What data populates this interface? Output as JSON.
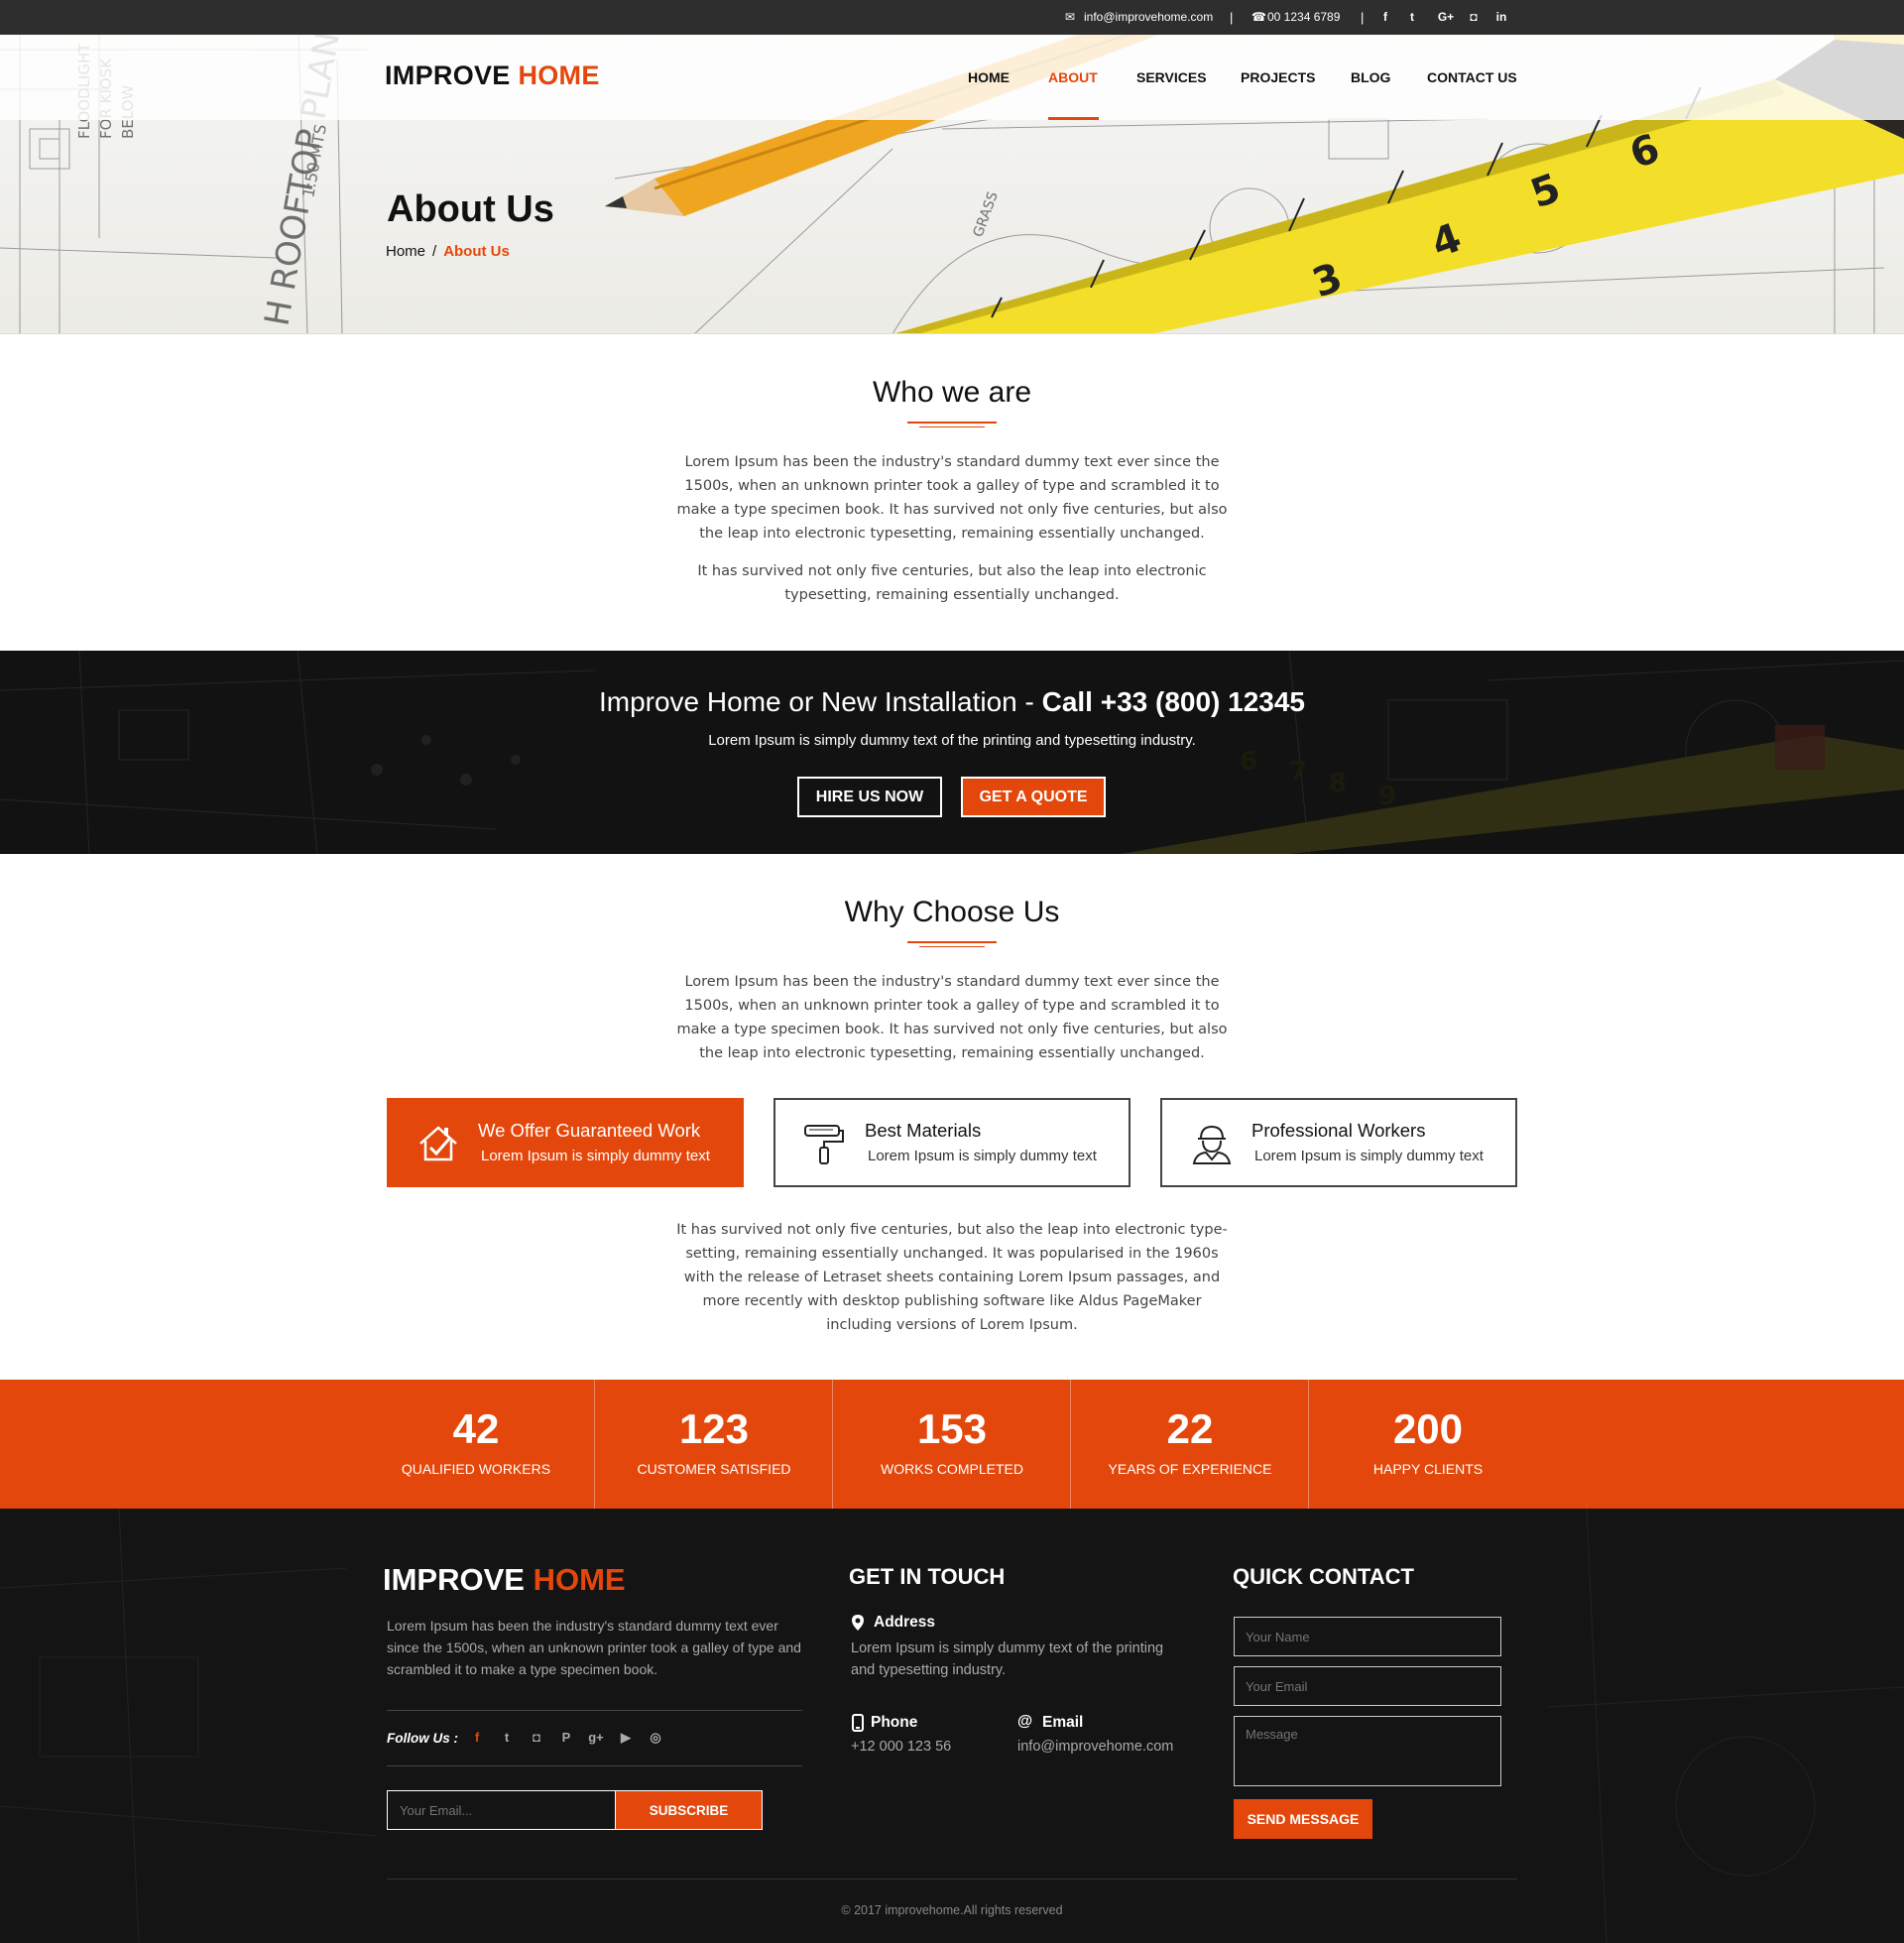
{
  "colors": {
    "accent": "#e4470b",
    "dark": "#1d1d1d",
    "footer_bg": "#141414"
  },
  "topbar": {
    "email": "info@improvehome.com",
    "phone": "00 1234 6789",
    "separator": "|",
    "social": [
      {
        "icon": "facebook-icon",
        "glyph": "f"
      },
      {
        "icon": "twitter-icon",
        "glyph": "t"
      },
      {
        "icon": "google-plus-icon",
        "glyph": "G+"
      },
      {
        "icon": "instagram-icon",
        "glyph": "◘"
      },
      {
        "icon": "linkedin-icon",
        "glyph": "in"
      }
    ]
  },
  "brand": {
    "part1": "IMPROVE",
    "part2": "HOME"
  },
  "nav": {
    "items": [
      {
        "label": "HOME",
        "active": false
      },
      {
        "label": "ABOUT",
        "active": true
      },
      {
        "label": "SERVICES",
        "active": false
      },
      {
        "label": "PROJECTS",
        "active": false
      },
      {
        "label": "BLOG",
        "active": false
      },
      {
        "label": "CONTACT US",
        "active": false
      }
    ]
  },
  "hero": {
    "title": "About Us",
    "breadcrumb": {
      "home": "Home",
      "separator": "/",
      "current": "About Us"
    }
  },
  "who": {
    "title": "Who we are",
    "p1": "Lorem Ipsum has been the industry's standard dummy text ever since the 1500s, when an unknown printer took a galley of type and scrambled it to make a type specimen book. It has survived not only five centuries, but also the leap into electronic typesetting, remaining essentially unchanged.",
    "p2": "It has survived not only five centuries, but also the leap into electronic typesetting, remaining essentially unchanged."
  },
  "cta": {
    "title_lead": "Improve Home or New Installation - ",
    "title_call": "Call +33 (800) 12345",
    "subtitle": "Lorem Ipsum is simply dummy text of the printing and typesetting industry.",
    "hire_label": "HIRE US NOW",
    "quote_label": "GET A QUOTE"
  },
  "why": {
    "title": "Why Choose Us",
    "p1": "Lorem Ipsum has been the industry's standard dummy text ever since the 1500s, when an unknown printer took a galley of type and scrambled it to make a type specimen book. It has survived not only five centuries, but also the leap into electronic typesetting, remaining essentially unchanged.",
    "features": [
      {
        "title": "We Offer Guaranteed Work",
        "text": "Lorem Ipsum is simply dummy text",
        "icon": "house-check-icon",
        "active": true
      },
      {
        "title": "Best Materials",
        "text": "Lorem Ipsum is simply dummy text",
        "icon": "paint-roller-icon",
        "active": false
      },
      {
        "title": "Professional Workers",
        "text": "Lorem Ipsum is simply dummy text",
        "icon": "worker-icon",
        "active": false
      }
    ],
    "p2": "It has survived not only five centuries, but also the leap into electronic type-setting, remaining essentially unchanged. It was popularised in the 1960s with the release of Letraset sheets containing Lorem Ipsum passages, and more recently with desktop publishing software like Aldus PageMaker including versions of Lorem Ipsum."
  },
  "stats": [
    {
      "value": "42",
      "label": "QUALIFIED WORKERS"
    },
    {
      "value": "123",
      "label": "CUSTOMER SATISFIED"
    },
    {
      "value": "153",
      "label": "WORKS COMPLETED"
    },
    {
      "value": "22",
      "label": "YEARS OF EXPERIENCE"
    },
    {
      "value": "200",
      "label": "HAPPY CLIENTS"
    }
  ],
  "footer": {
    "about": "Lorem Ipsum has been the industry's standard dummy text ever since the 1500s, when an unknown printer took a galley of type and scrambled it to make a type specimen book.",
    "follow_label": "Follow Us :",
    "social": [
      {
        "icon": "facebook-icon",
        "glyph": "f"
      },
      {
        "icon": "twitter-icon",
        "glyph": "t"
      },
      {
        "icon": "instagram-icon",
        "glyph": "◘"
      },
      {
        "icon": "pinterest-icon",
        "glyph": "P"
      },
      {
        "icon": "google-plus-icon",
        "glyph": "g+"
      },
      {
        "icon": "youtube-icon",
        "glyph": "▶"
      },
      {
        "icon": "dribbble-icon",
        "glyph": "◎"
      }
    ],
    "subscribe_placeholder": "Your Email...",
    "subscribe_label": "SUBSCRIBE",
    "touch": {
      "title": "GET IN TOUCH",
      "address_label": "Address",
      "address_text": "Lorem Ipsum is simply dummy text of the printing and typesetting industry.",
      "phone_label": "Phone",
      "phone_value": "+12 000 123 56",
      "email_label": "Email",
      "email_value": "info@improvehome.com"
    },
    "quick": {
      "title": "QUICK CONTACT",
      "name_placeholder": "Your Name",
      "email_placeholder": "Your Email",
      "message_placeholder": "Message",
      "send_label": "SEND MESSAGE"
    },
    "copyright": "© 2017 improvehome.All rights reserved"
  }
}
